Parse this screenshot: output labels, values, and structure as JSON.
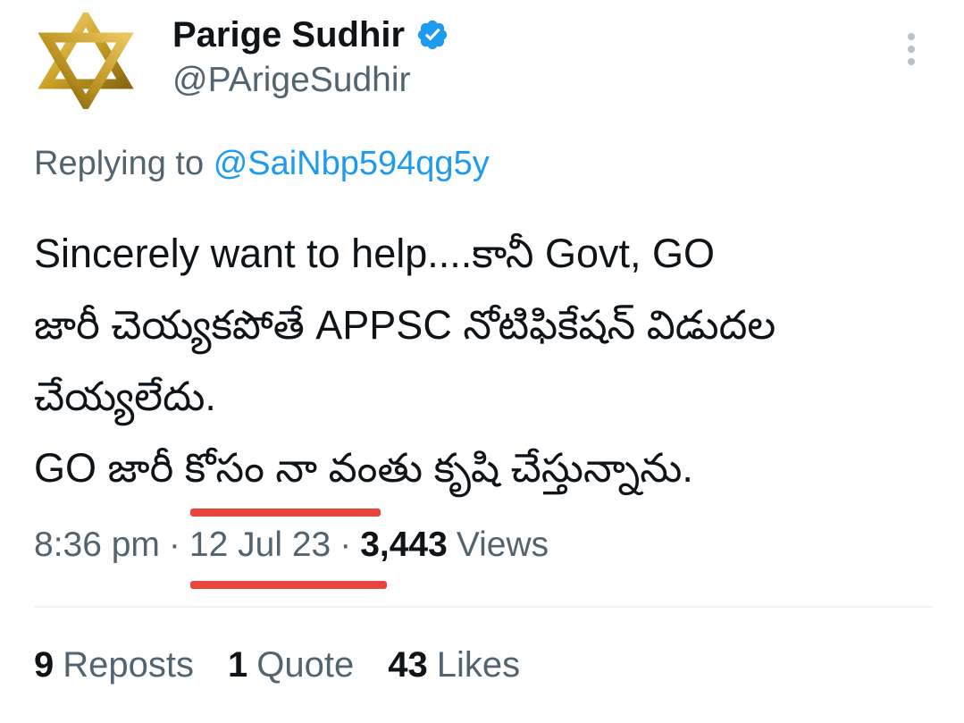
{
  "author": {
    "display_name": "Parige Sudhir",
    "handle": "@PArigeSudhir",
    "verified": true,
    "avatar": "gold-star-of-david-icon"
  },
  "reply": {
    "prefix": "Replying to",
    "mention": "@SaiNbp594qg5y"
  },
  "tweet": {
    "lines": [
      "Sincerely want to help....కానీ Govt, GO",
      "జారీ  చెయ్యకపోతే APPSC నోటిఫికేషన్ విడుదల",
      "చేయ్యలేదు.",
      "GO  జారీ కోసం నా వంతు కృషి చేస్తున్నాను."
    ]
  },
  "meta": {
    "time": "8:36 pm",
    "separator": "·",
    "date": "12 Jul 23",
    "views_count": "3,443",
    "views_label": "Views"
  },
  "stats": {
    "reposts_count": "9",
    "reposts_label": "Reposts",
    "quotes_count": "1",
    "quotes_label": "Quote",
    "likes_count": "43",
    "likes_label": "Likes"
  },
  "colors": {
    "text_primary": "#0f1419",
    "text_secondary": "#536471",
    "link": "#1d9bf0",
    "verified_badge": "#1d9bf0",
    "annotation_underline": "#e8453c",
    "avatar_gold": "#c9a227"
  },
  "icons": {
    "verified": "verified-badge-icon",
    "more": "more-vertical-icon"
  }
}
